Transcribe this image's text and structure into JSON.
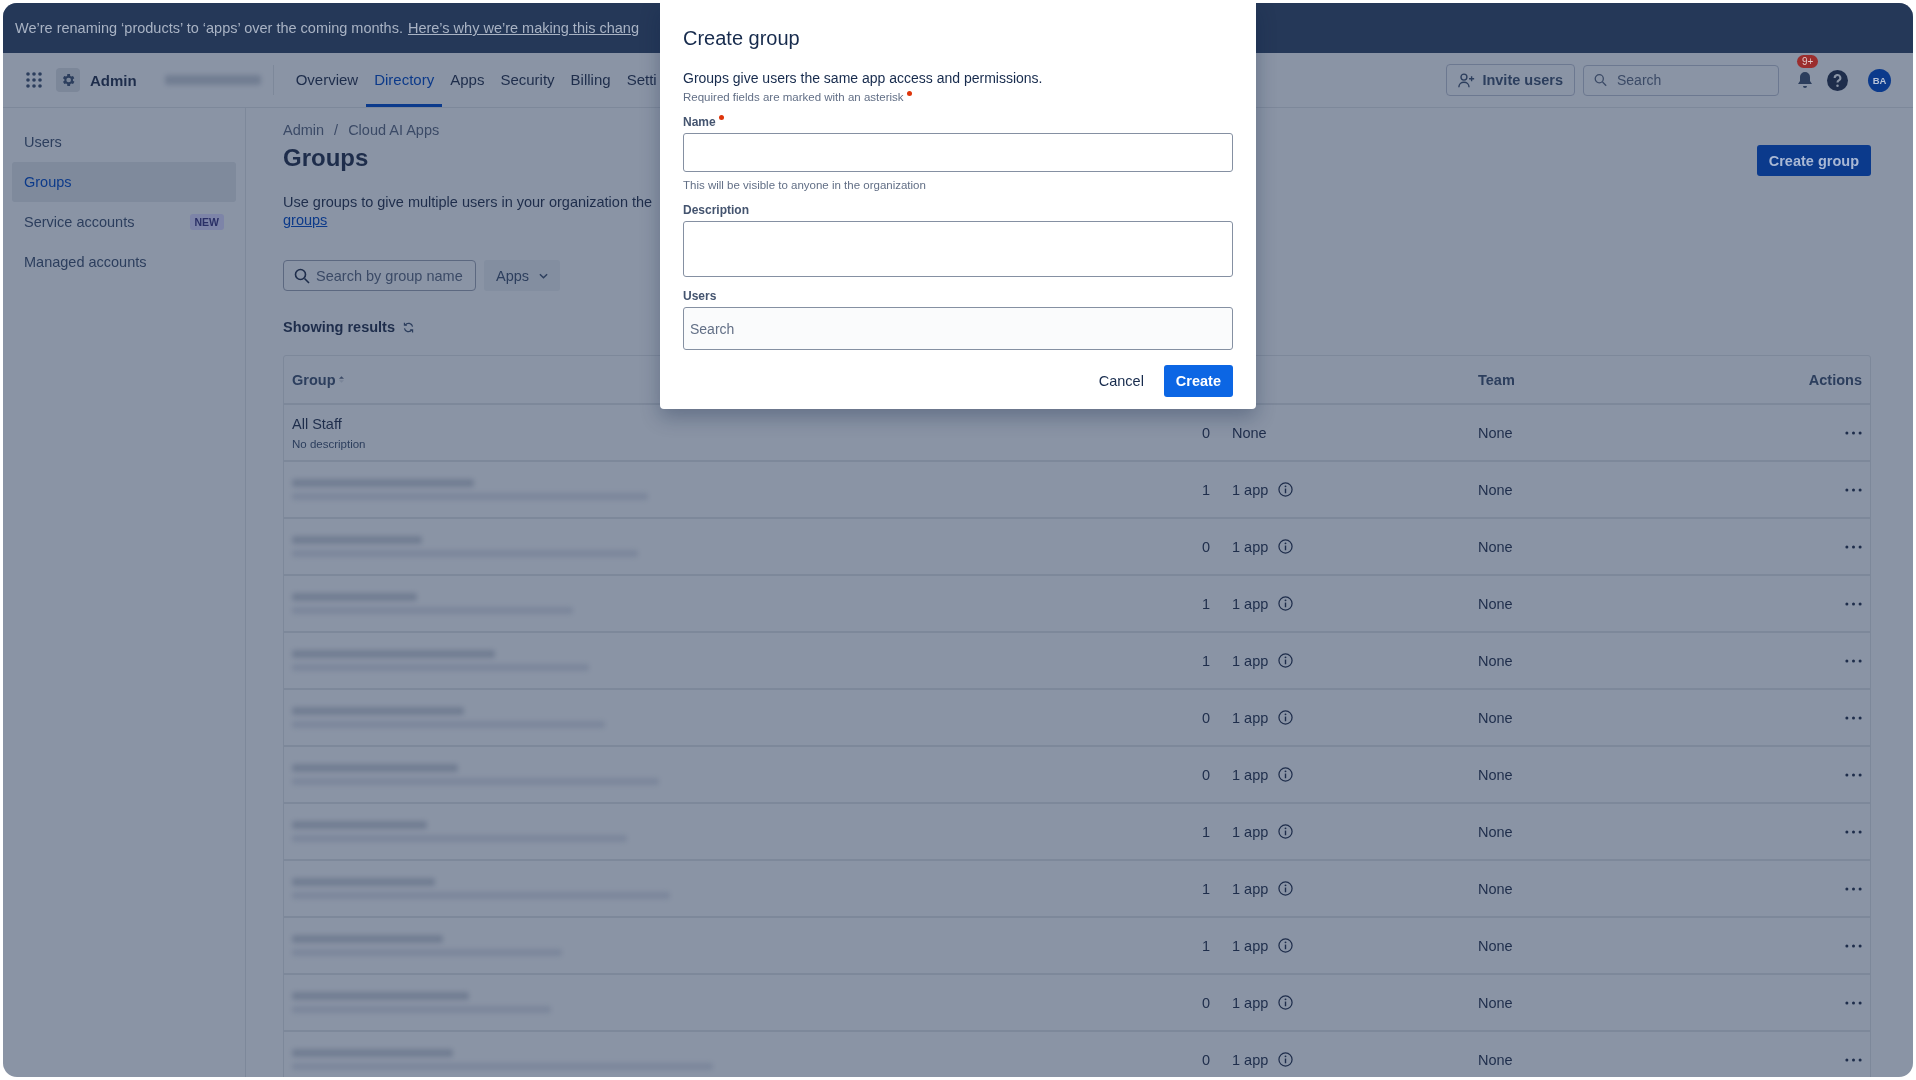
{
  "banner": {
    "text": "We’re renaming ‘products’ to ‘apps’ over the coming months.",
    "link": "Here’s why we’re making this chang"
  },
  "header": {
    "product": "Admin",
    "tabs": [
      {
        "label": "Overview",
        "selected": false
      },
      {
        "label": "Directory",
        "selected": true
      },
      {
        "label": "Apps",
        "selected": false
      },
      {
        "label": "Security",
        "selected": false
      },
      {
        "label": "Billing",
        "selected": false
      },
      {
        "label": "Setti",
        "selected": false
      }
    ],
    "invite_button": "Invite users",
    "search": {
      "placeholder": "Search"
    },
    "notification_badge": "9+",
    "avatar": "BA"
  },
  "sidebar": {
    "items": [
      {
        "label": "Users",
        "selected": false
      },
      {
        "label": "Groups",
        "selected": true
      },
      {
        "label": "Service accounts",
        "selected": false,
        "badge": "NEW"
      },
      {
        "label": "Managed accounts",
        "selected": false
      }
    ]
  },
  "breadcrumbs": [
    "Admin",
    "Cloud AI Apps"
  ],
  "breadcrumb_separator": "/",
  "page": {
    "title": "Groups",
    "description": "Use groups to give multiple users in your organization the",
    "description_link": "groups",
    "create_button": "Create group",
    "search": {
      "placeholder": "Search by group name"
    },
    "filter": "Apps",
    "results_label": "Showing results"
  },
  "table": {
    "columns": [
      "Group",
      "Team",
      "Actions"
    ],
    "rows": [
      {
        "kind": "named",
        "group": "All Staff",
        "description": "No description",
        "count": "0",
        "apps": "None",
        "info": false,
        "team": "None"
      },
      {
        "kind": "redacted",
        "count": "1",
        "apps": "1 app",
        "info": true,
        "team": "None"
      },
      {
        "kind": "redacted",
        "count": "0",
        "apps": "1 app",
        "info": true,
        "team": "None"
      },
      {
        "kind": "redacted",
        "count": "1",
        "apps": "1 app",
        "info": true,
        "team": "None"
      },
      {
        "kind": "redacted",
        "count": "1",
        "apps": "1 app",
        "info": true,
        "team": "None"
      },
      {
        "kind": "redacted",
        "count": "0",
        "apps": "1 app",
        "info": true,
        "team": "None"
      },
      {
        "kind": "redacted",
        "count": "0",
        "apps": "1 app",
        "info": true,
        "team": "None"
      },
      {
        "kind": "redacted",
        "count": "1",
        "apps": "1 app",
        "info": true,
        "team": "None"
      },
      {
        "kind": "redacted",
        "count": "1",
        "apps": "1 app",
        "info": true,
        "team": "None"
      },
      {
        "kind": "redacted",
        "count": "1",
        "apps": "1 app",
        "info": true,
        "team": "None"
      },
      {
        "kind": "redacted",
        "count": "0",
        "apps": "1 app",
        "info": true,
        "team": "None"
      },
      {
        "kind": "redacted",
        "count": "0",
        "apps": "1 app",
        "info": true,
        "team": "None"
      }
    ]
  },
  "dialog": {
    "title": "Create group",
    "intro": "Groups give users the same app access and permissions.",
    "required_note": "Required fields are marked with an asterisk",
    "fields": [
      {
        "label": "Name",
        "required": true,
        "kind": "text",
        "help": "This will be visible to anyone in the organization"
      },
      {
        "label": "Description",
        "required": false,
        "kind": "textarea"
      },
      {
        "label": "Users",
        "required": false,
        "kind": "search",
        "placeholder": "Search"
      }
    ],
    "cancel": "Cancel",
    "submit": "Create"
  }
}
